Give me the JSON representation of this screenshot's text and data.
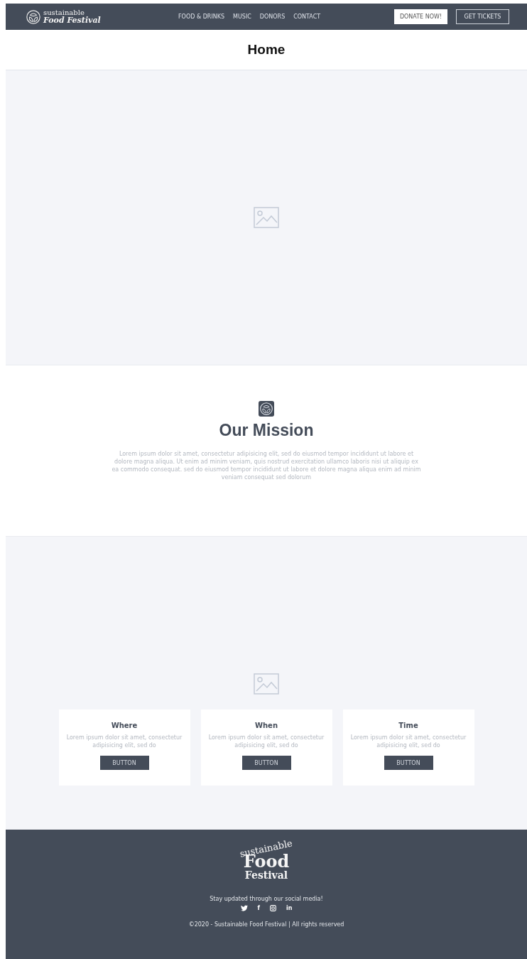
{
  "header": {
    "logo": {
      "line1": "sustainable",
      "line2": "Food Festival"
    },
    "nav": [
      {
        "label": "FOOD & DRINKS"
      },
      {
        "label": "MUSIC"
      },
      {
        "label": "DONORS"
      },
      {
        "label": "CONTACT"
      }
    ],
    "buttons": [
      {
        "label": "DONATE NOW!",
        "kind": "filled"
      },
      {
        "label": "GET TICKETS",
        "kind": "outline"
      }
    ]
  },
  "page_title": "Home",
  "mission": {
    "title": "Our Mission",
    "text": "Lorem ipsum dolor sit amet, consectetur adipisicing elit, sed do eiusmod tempor incididunt ut labore et dolore magna aliqua. Ut enim ad minim veniam, quis nostrud exercitation ullamco laboris nisi ut aliquip ex ea commodo consequat. sed do eiusmod tempor incididunt ut labore et dolore magna aliqua enim ad minim veniam consequat sed dolorum"
  },
  "info_cards": [
    {
      "title": "Where",
      "text": "Lorem ipsum dolor sit amet, consectetur adipisicing elit, sed do",
      "button": "BUTTON"
    },
    {
      "title": "When",
      "text": "Lorem ipsum dolor sit amet, consectetur adipisicing elit, sed do",
      "button": "BUTTON"
    },
    {
      "title": "Time",
      "text": "Lorem ipsum dolor sit amet, consectetur adipisicing elit, sed do",
      "button": "BUTTON"
    }
  ],
  "footer": {
    "logo": {
      "line1": "sustainable",
      "line2": "Food",
      "line3": "Festival"
    },
    "social_text": "Stay updated through our social media!",
    "social": [
      {
        "kind": "twitter"
      },
      {
        "kind": "facebook",
        "glyph": "f"
      },
      {
        "kind": "instagram"
      },
      {
        "kind": "linkedin",
        "glyph": "in"
      }
    ],
    "copyright": "©2020 - Sustainable Food Festival | All rights reserved"
  }
}
